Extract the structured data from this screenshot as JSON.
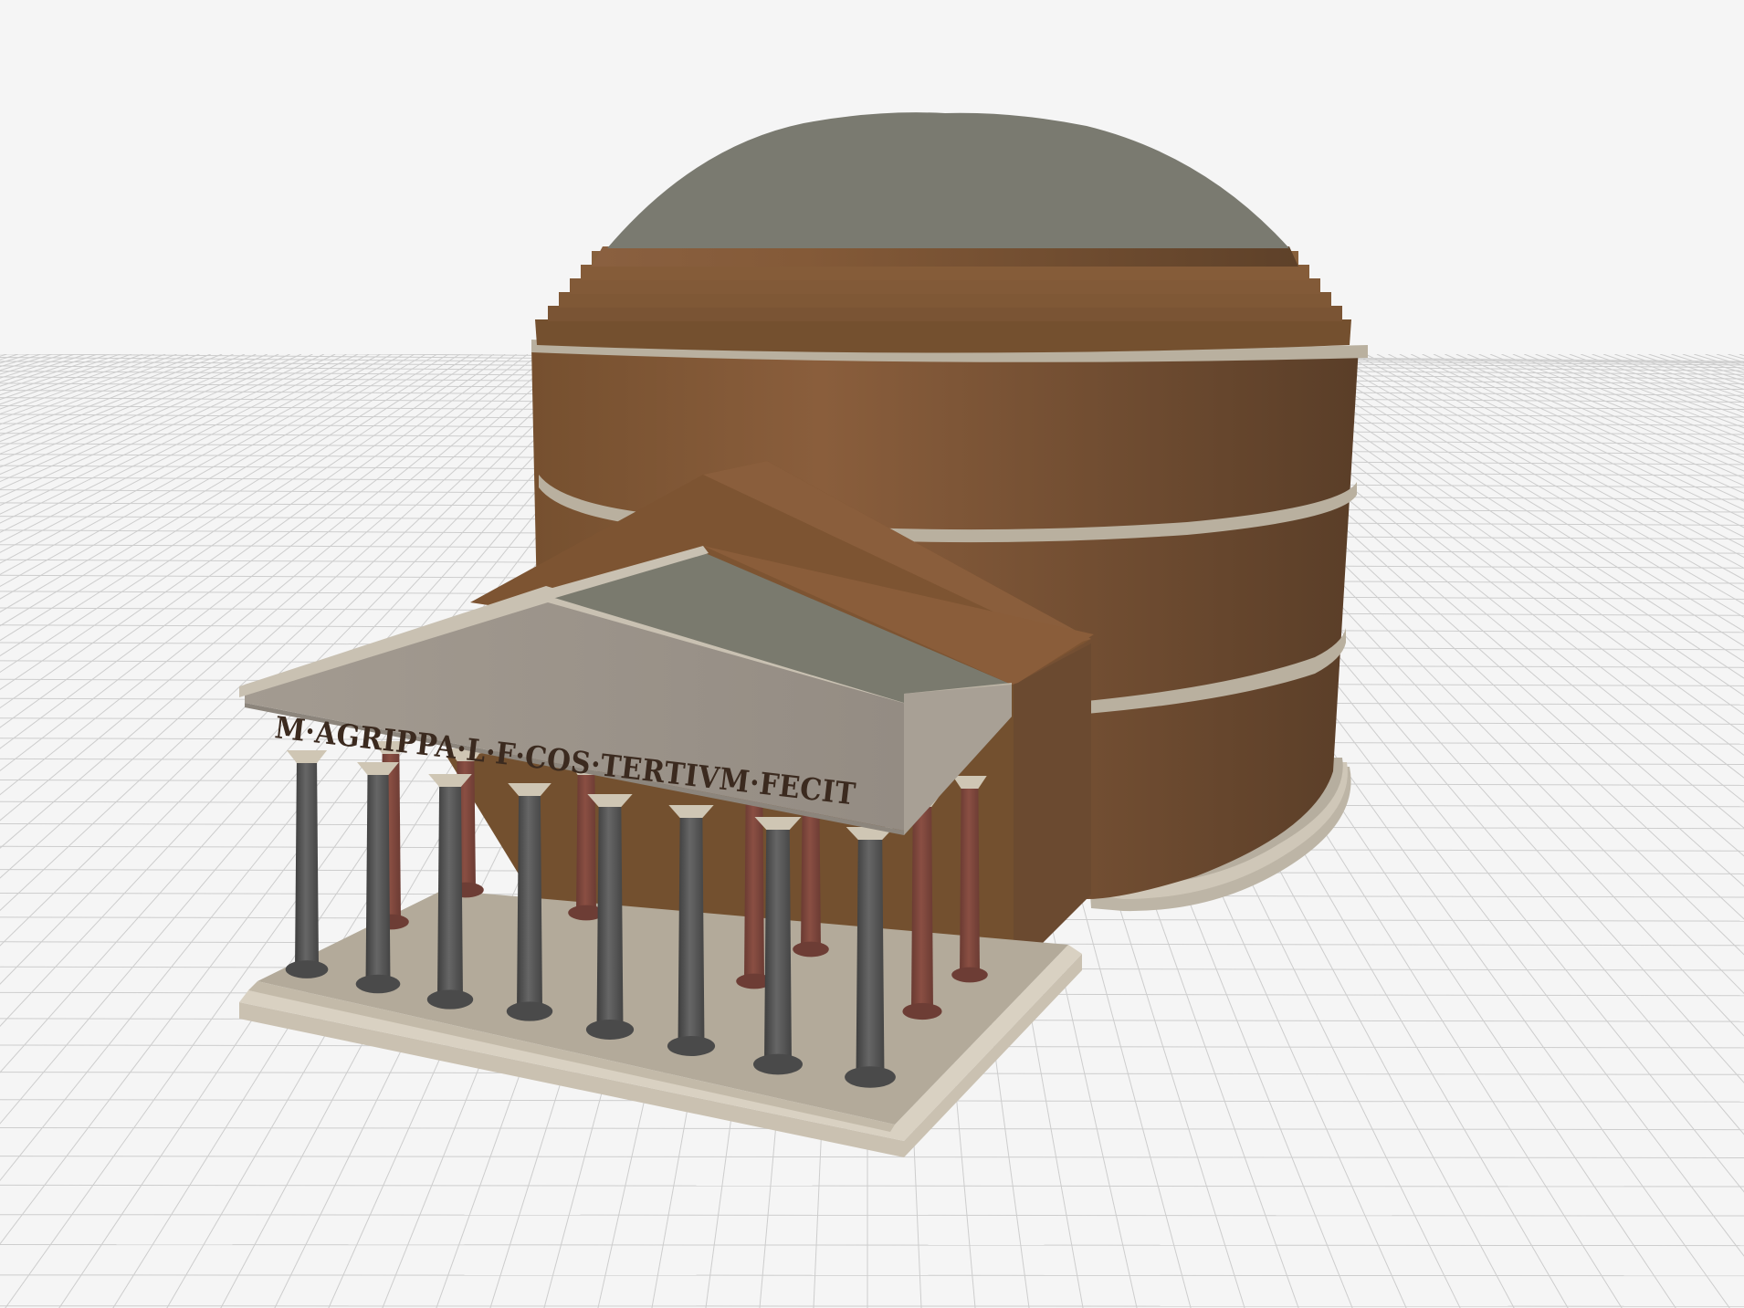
{
  "model": {
    "inscription": "M·AGRIPPA·L·F·COS·TERTIVM·FECIT"
  },
  "colors": {
    "background": "#f5f5f5",
    "grid_line": "#c9c9c9",
    "drum_light": "#8a5e3c",
    "drum_dark": "#5e4129",
    "dome_cap": "#7a7a70",
    "cornice": "#b5ad9c",
    "pediment": "#9b938a",
    "portico_roof_grey": "#7a7a6e",
    "portico_roof_brown": "#7d5432",
    "base": "#b3aa9a",
    "column_front": "#555555",
    "column_back": "#7d453b",
    "capital": "#cfc6b4",
    "inscription_text": "#3b2a1f"
  },
  "icons": {
    "ground": "grid-plane",
    "building": "pantheon-model"
  }
}
